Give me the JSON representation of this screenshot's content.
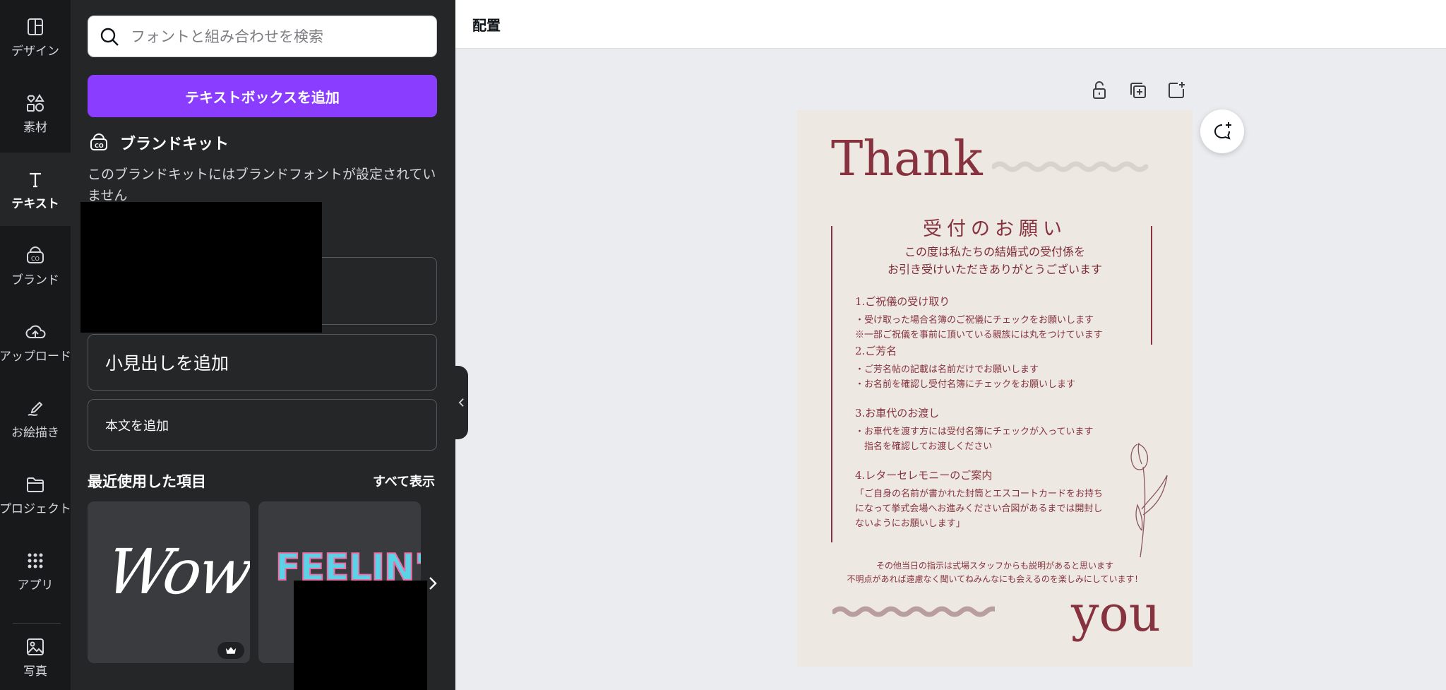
{
  "rail": {
    "items": [
      {
        "label": "デザイン",
        "icon": "layout-icon"
      },
      {
        "label": "素材",
        "icon": "shapes-icon"
      },
      {
        "label": "テキスト",
        "icon": "text-icon"
      },
      {
        "label": "ブランド",
        "icon": "brand-icon"
      },
      {
        "label": "アップロード",
        "icon": "cloud-upload-icon"
      },
      {
        "label": "お絵描き",
        "icon": "draw-icon"
      },
      {
        "label": "プロジェクト",
        "icon": "folder-icon"
      },
      {
        "label": "アプリ",
        "icon": "apps-grid-icon"
      },
      {
        "label": "写真",
        "icon": "photo-icon"
      }
    ]
  },
  "panel": {
    "search_placeholder": "フォントと組み合わせを検索",
    "add_textbox_label": "テキストボックスを追加",
    "brand_kit_title": "ブランドキット",
    "brand_kit_desc": "このブランドキットにはブランドフォントが設定されていません",
    "subheading_label": "小見出しを追加",
    "body_label": "本文を追加",
    "recent_title": "最近使用した項目",
    "show_all": "すべて表示",
    "recent": [
      {
        "text": "Wow!",
        "premium": true
      },
      {
        "text": "FEELIN'"
      }
    ]
  },
  "topbar": {
    "position_label": "配置"
  },
  "card": {
    "thank": "Thank",
    "you": "you",
    "title": "受付のお願い",
    "intro": [
      "この度は私たちの結婚式の受付係を",
      "お引き受けいただきありがとうございます"
    ],
    "sections": [
      {
        "title": "1.ご祝儀の受け取り",
        "lines": [
          "・受け取った場合名簿のご祝儀にチェックをお願いします",
          "※一部ご祝儀を事前に頂いている親族には丸をつけています"
        ]
      },
      {
        "title": "2.ご芳名",
        "lines": [
          "・ご芳名帖の記載は名前だけでお願いします",
          "・お名前を確認し受付名簿にチェックをお願いします"
        ]
      },
      {
        "title": "3.お車代のお渡し",
        "lines": [
          "・お車代を渡す方には受付名簿にチェックが入っています",
          "　指名を確認してお渡しください"
        ]
      },
      {
        "title": "4.レターセレモニーのご案内",
        "lines": [
          "「ご自身の名前が書かれた封筒とエスコートカードをお持ち",
          "になって挙式会場へお進みください合図があるまでは開封し",
          "ないようにお願いします」"
        ]
      }
    ],
    "footer": [
      "その他当日の指示は式場スタッフからも説明があると思います",
      "不明点があれば遠慮なく聞いてねみんなにも会えるのを楽しみにしています！"
    ],
    "accent_color": "#86323f",
    "background_color": "#ede9e2"
  },
  "colors": {
    "brand_purple": "#8b3dff",
    "panel_bg": "#252628",
    "rail_bg": "#18191b"
  }
}
